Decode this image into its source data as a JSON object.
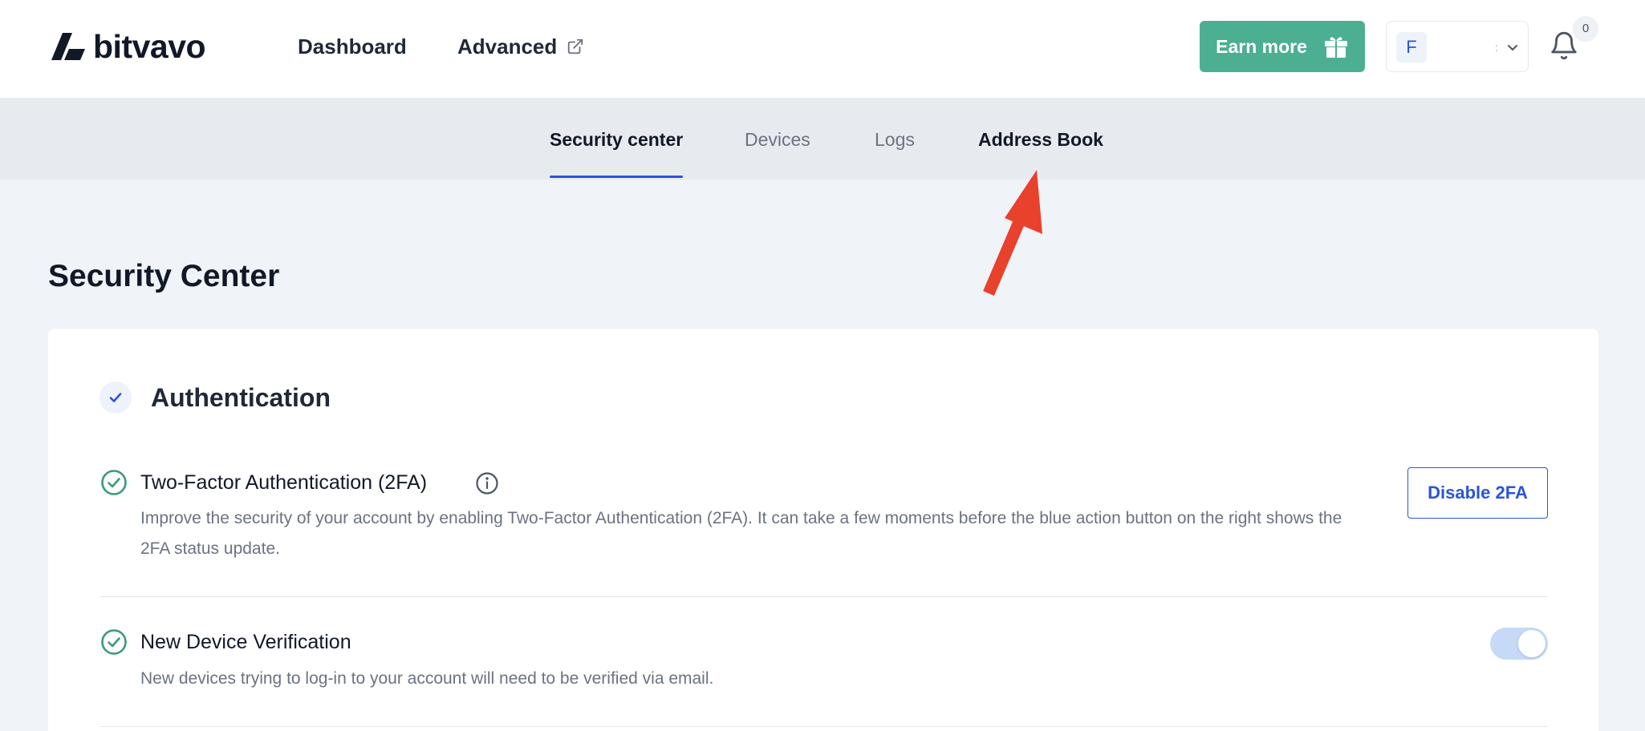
{
  "header": {
    "logo_text": "bitvavo",
    "nav": {
      "dashboard": "Dashboard",
      "advanced": "Advanced"
    },
    "earn_more_label": "Earn more",
    "account": {
      "avatar_initial": "F",
      "name_fragment": ":"
    },
    "notifications_count": "0"
  },
  "tabs": {
    "security_center": "Security center",
    "devices": "Devices",
    "logs": "Logs",
    "address_book": "Address Book",
    "active": "security_center"
  },
  "page": {
    "title": "Security Center"
  },
  "authentication": {
    "title": "Authentication",
    "two_factor": {
      "title": "Two-Factor Authentication (2FA)",
      "description": "Improve the security of your account by enabling Two-Factor Authentication (2FA). It can take a few moments before the blue action button on the right shows the 2FA status update.",
      "button_label": "Disable 2FA"
    },
    "new_device": {
      "title": "New Device Verification",
      "description": "New devices trying to log-in to your account will need to be verified via email.",
      "enabled": true
    }
  },
  "colors": {
    "brand_green": "#4caf91",
    "accent_blue": "#2b54d6",
    "annotation_red": "#e8412c"
  }
}
